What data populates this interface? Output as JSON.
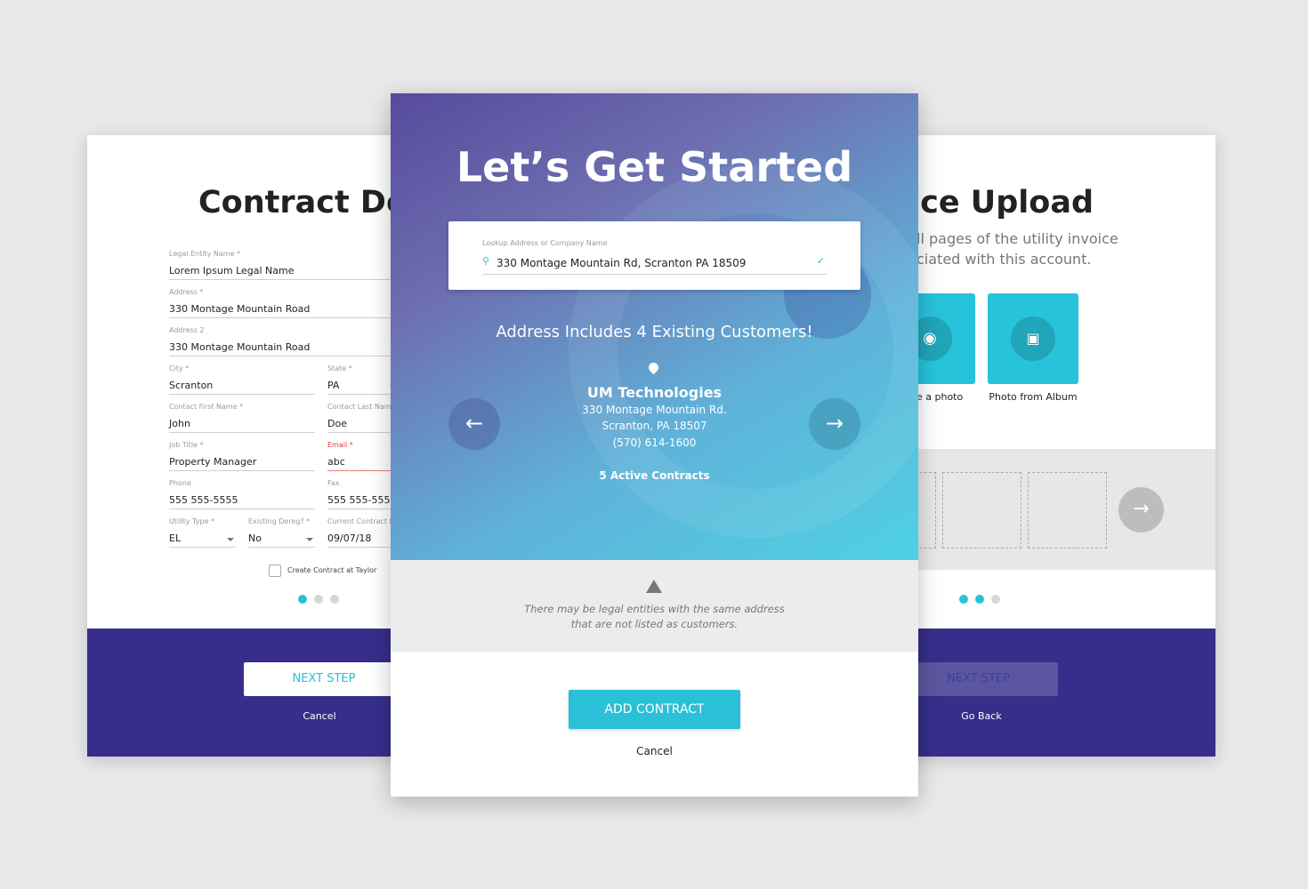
{
  "left_card": {
    "title": "Contract Det",
    "fields": [
      {
        "label": "Legal Entity Name *",
        "value": "Lorem Ipsum Legal Name"
      },
      {
        "label": "Address *",
        "value": "330 Montage Mountain Road"
      },
      {
        "label": "Address 2",
        "value": "330 Montage Mountain Road"
      },
      {
        "label": "City *",
        "value": "Scranton"
      },
      {
        "label": "State *",
        "value": "PA"
      },
      {
        "label": "Contact First Name *",
        "value": "John"
      },
      {
        "label": "Contact Last Name",
        "value": "Doe"
      },
      {
        "label": "Job Title *",
        "value": "Property Manager"
      },
      {
        "label": "Email *",
        "value": "abc"
      },
      {
        "label": "Phone",
        "value": "555 555-5555"
      },
      {
        "label": "Fax",
        "value": "555 555-5555"
      },
      {
        "label": "Utility Type *",
        "value": "EL"
      },
      {
        "label": "Existing Dereg? *",
        "value": "No"
      },
      {
        "label": "Current Contract E",
        "value": "09/07/18"
      }
    ],
    "checkbox_label": "Create Contract at Taylor",
    "checkbox_checked": false,
    "next_label": "NEXT STEP",
    "cancel_label": "Cancel",
    "step": 1
  },
  "center_card": {
    "title": "Let’s Get Started",
    "lookup_label": "Lookup Address or Company Name",
    "lookup_value": "330 Montage Mountain Rd, Scranton PA 18509",
    "headline": "Address Includes 4 Existing Customers!",
    "customer": {
      "name": "UM Technologies",
      "address1": "330 Montage Mountain Rd.",
      "address2": "Scranton, PA 18507",
      "phone": "(570) 614-1600",
      "contracts": "5 Active Contracts"
    },
    "warning": "There may be legal entities with the same address that are not listed as customers.",
    "add_label": "ADD CONTRACT",
    "cancel_label": "Cancel",
    "colors": {
      "accent": "#29c0d8",
      "grad_start": "#5a4a9e",
      "grad_end": "#4fd0e0"
    }
  },
  "right_card": {
    "title": "oice Upload",
    "subtitle1": "ll pages of the utility invoice",
    "subtitle2": "ciated with this account.",
    "take_photo_label": "e a photo",
    "album_label": "Photo from Album",
    "next_label": "NEXT STEP",
    "back_label": "Go Back",
    "step": 2
  }
}
